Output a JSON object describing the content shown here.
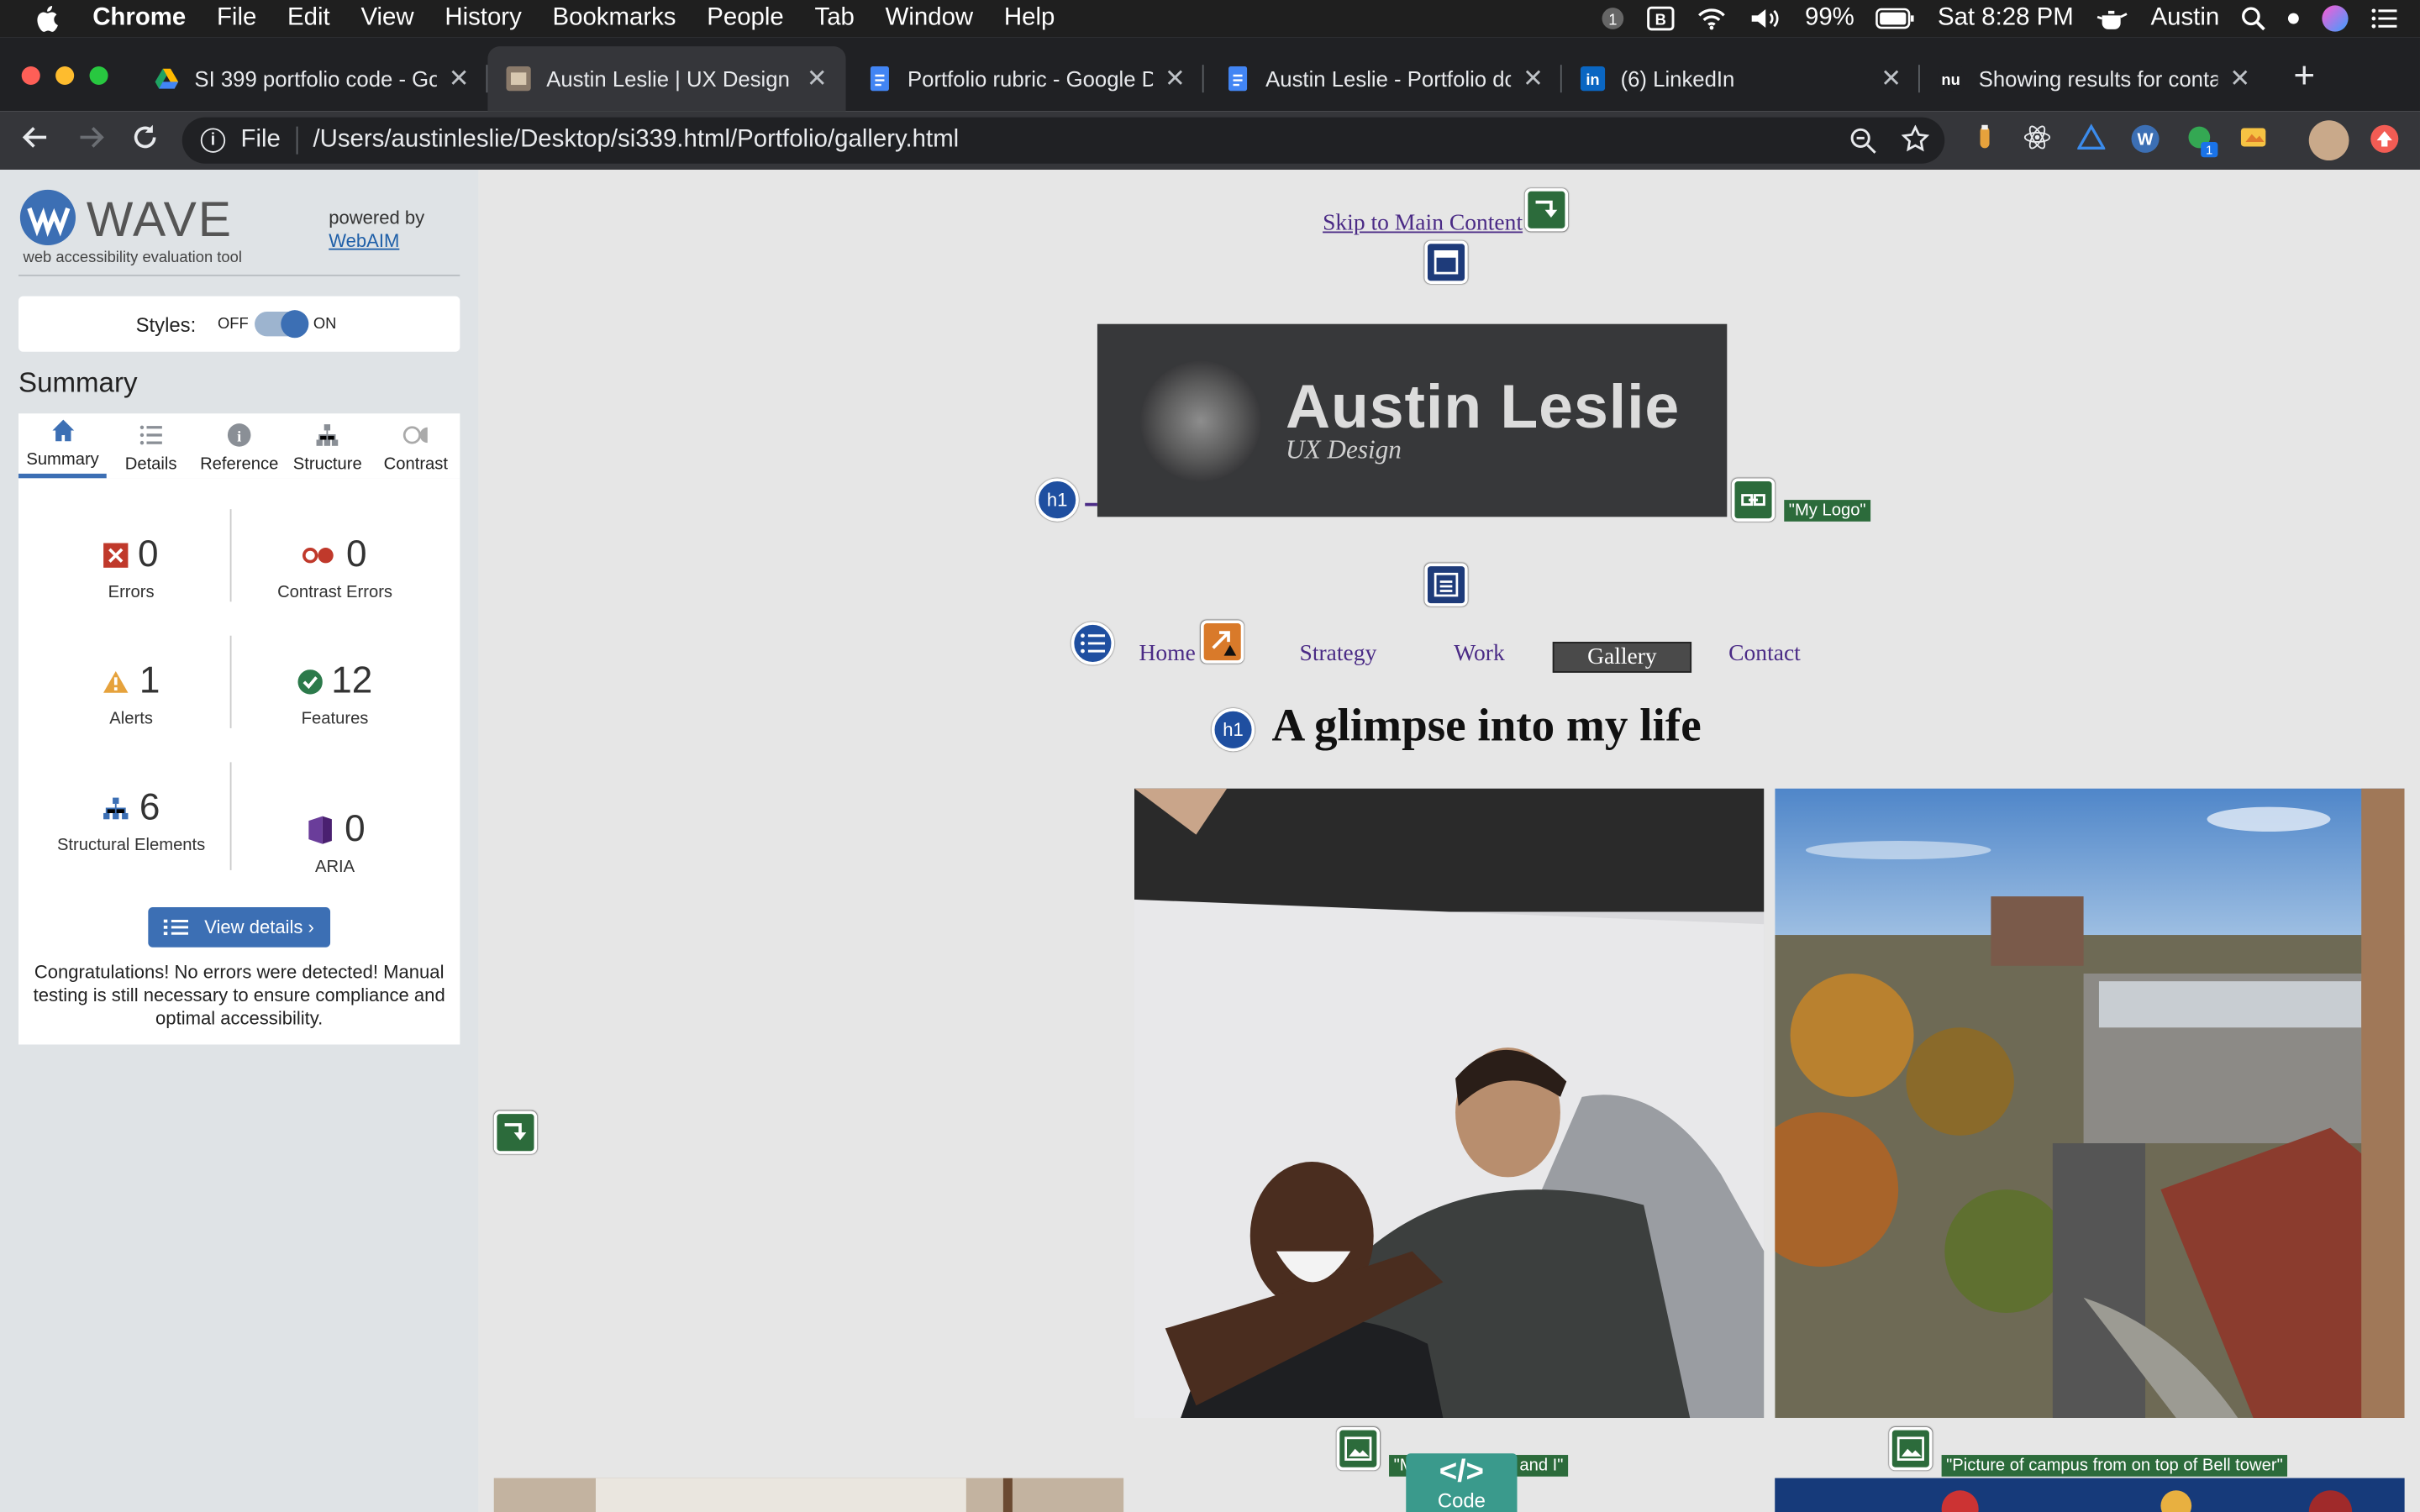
{
  "menubar": {
    "app": "Chrome",
    "items": [
      "File",
      "Edit",
      "View",
      "History",
      "Bookmarks",
      "People",
      "Tab",
      "Window",
      "Help"
    ],
    "battery": "99%",
    "clock": "Sat 8:28 PM",
    "user": "Austin"
  },
  "tabs": [
    {
      "title": "SI 399 portfolio code - Go",
      "icon": "google-drive-icon"
    },
    {
      "title": "Austin Leslie | UX Design",
      "icon": "page-favicon-icon"
    },
    {
      "title": "Portfolio rubric - Google D",
      "icon": "google-docs-icon"
    },
    {
      "title": "Austin Leslie - Portfolio do",
      "icon": "google-docs-icon"
    },
    {
      "title": "(6) LinkedIn",
      "icon": "linkedin-icon"
    },
    {
      "title": "Showing results for conta",
      "icon": "nu-icon"
    }
  ],
  "address": {
    "scheme": "File",
    "url": "/Users/austinleslie/Desktop/si339.html/Portfolio/gallery.html"
  },
  "wave": {
    "title": "WAVE",
    "subtitle": "web accessibility evaluation tool",
    "powered_by": "powered by",
    "webaim": "WebAIM",
    "styles_label": "Styles:",
    "off": "OFF",
    "on": "ON",
    "summary_heading": "Summary",
    "tabs": [
      "Summary",
      "Details",
      "Reference",
      "Structure",
      "Contrast"
    ],
    "stats": {
      "errors": {
        "value": "0",
        "label": "Errors"
      },
      "contrast": {
        "value": "0",
        "label": "Contrast Errors"
      },
      "alerts": {
        "value": "1",
        "label": "Alerts"
      },
      "features": {
        "value": "12",
        "label": "Features"
      },
      "structural": {
        "value": "6",
        "label": "Structural Elements"
      },
      "aria": {
        "value": "0",
        "label": "ARIA"
      }
    },
    "view_details": "View details ›",
    "congrats": "Congratulations! No errors were detected! Manual testing is still necessary to ensure compliance and optimal accessibility."
  },
  "page": {
    "skip_link": "Skip to Main Content",
    "logo_name": "Austin Leslie",
    "logo_sub": "UX Design",
    "logo_alt": "\"My Logo\"",
    "nav": [
      "Home",
      "Strategy",
      "Work",
      "Gallery",
      "Contact"
    ],
    "heading": "A glimpse into my life",
    "photo1_alt": "\"My friend Jalen and I\"",
    "photo2_alt": "\"Picture of campus from on top of Bell tower\"",
    "code_glyph": "</>",
    "code_label": "Code"
  }
}
